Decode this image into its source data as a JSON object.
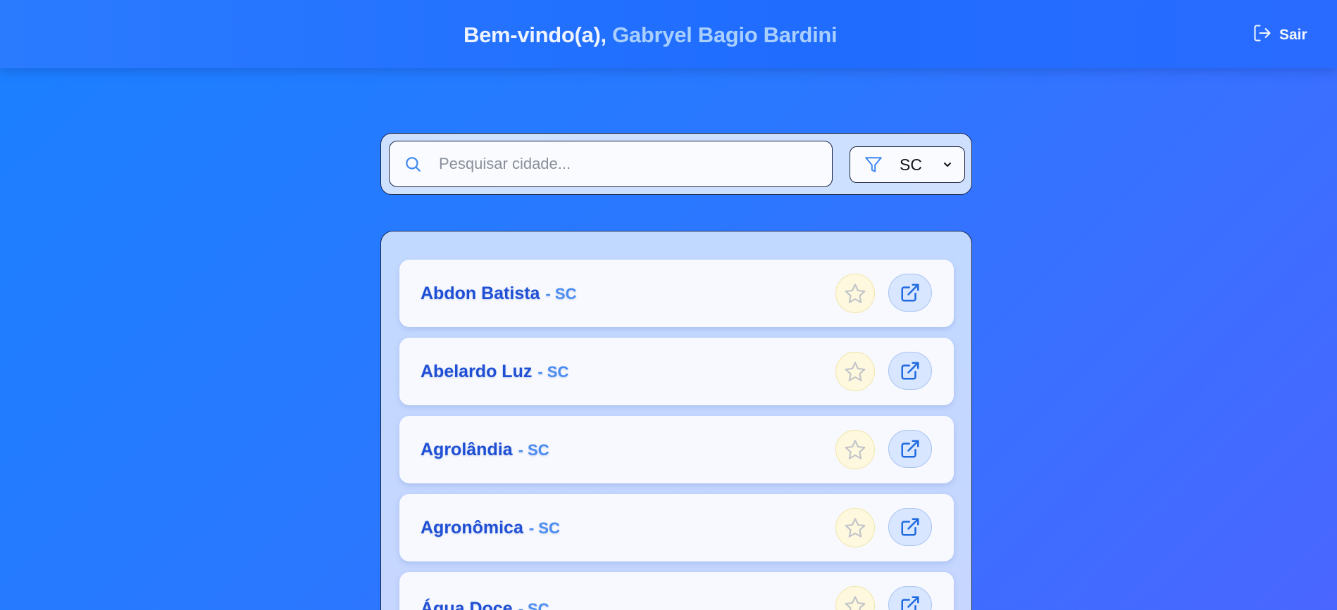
{
  "header": {
    "greeting_prefix": "Bem-vindo(a), ",
    "user_name": "Gabryel Bagio Bardini",
    "logout_label": "Sair"
  },
  "search": {
    "placeholder": "Pesquisar cidade...",
    "value": "",
    "state_filter": "SC"
  },
  "cities": [
    {
      "name": "Abdon Batista",
      "uf": "- SC"
    },
    {
      "name": "Abelardo Luz",
      "uf": "- SC"
    },
    {
      "name": "Agrolândia",
      "uf": "- SC"
    },
    {
      "name": "Agronômica",
      "uf": "- SC"
    },
    {
      "name": "Água Doce",
      "uf": "- SC"
    }
  ],
  "icons": {
    "search": "search-icon",
    "filter": "filter-icon",
    "favorite": "star-icon",
    "open": "external-link-icon",
    "logout": "logout-icon"
  },
  "colors": {
    "accent": "#1f4fd4",
    "uf": "#4a8cf0",
    "user_name": "#a9cfff"
  }
}
